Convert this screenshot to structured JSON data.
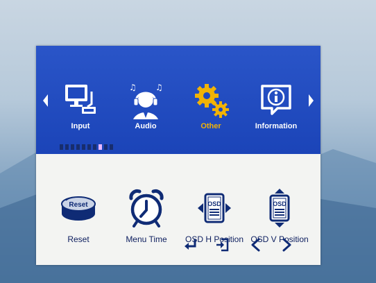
{
  "main_menu": {
    "items": [
      {
        "label": "Input",
        "icon": "computer-monitor-icon"
      },
      {
        "label": "Audio",
        "icon": "headset-person-icon"
      },
      {
        "label": "Other",
        "icon": "gears-icon"
      },
      {
        "label": "Information",
        "icon": "info-icon"
      }
    ],
    "selected_index": 2,
    "page_dots_total": 10,
    "page_dot_active": 7
  },
  "sub_menu": {
    "items": [
      {
        "label": "Reset",
        "icon": "reset-icon"
      },
      {
        "label": "Menu Time",
        "icon": "alarm-clock-icon"
      },
      {
        "label": "OSD H Position",
        "icon": "osd-h-position-icon"
      },
      {
        "label": "OSD V Position",
        "icon": "osd-v-position-icon"
      }
    ],
    "reset_icon_text": "Reset",
    "osd_icon_text": "OSD"
  },
  "nav_hints": [
    {
      "name": "enter-icon"
    },
    {
      "name": "exit-icon"
    },
    {
      "name": "chevron-left-icon"
    },
    {
      "name": "chevron-right-icon"
    }
  ],
  "colors": {
    "panel_blue": "#1f49be",
    "panel_light": "#f3f4f2",
    "active_text": "#f2b305",
    "icon_dark_blue": "#0f2b75",
    "active_dot": "#e8b8ff"
  }
}
